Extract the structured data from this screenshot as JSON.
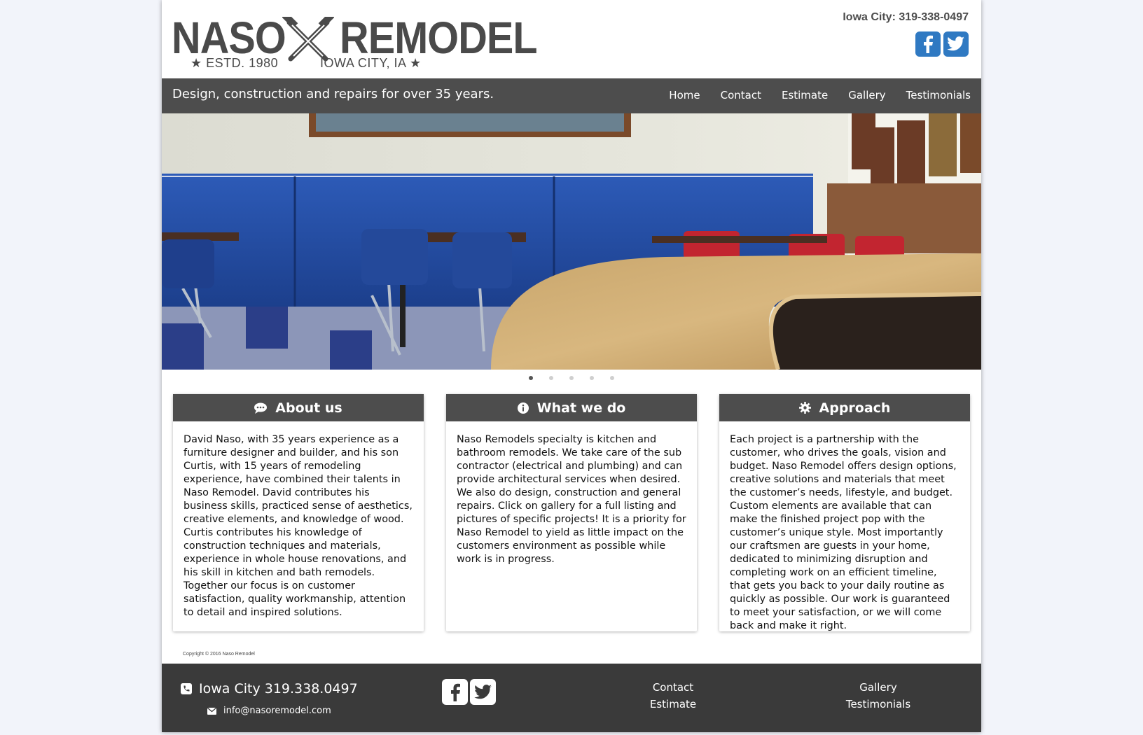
{
  "brand": {
    "logo_left": "NASO",
    "logo_right": "REMODEL",
    "est": "★ ESTD. 1980",
    "location": "IOWA CITY, IA ★",
    "logo_color": "#4a4a4a"
  },
  "header": {
    "phone": "Iowa City: 319-338-0497",
    "social_icons": [
      "facebook-icon",
      "twitter-icon"
    ],
    "social_color": "#2f79c2"
  },
  "navbar": {
    "tagline": "Design, construction and repairs for over 35 years.",
    "items": [
      "Home",
      "Contact",
      "Estimate",
      "Gallery",
      "Testimonials"
    ],
    "background": "#4d4d4d"
  },
  "slider": {
    "image_description_icon": "restaurant-interior-photo",
    "slide_count": 5,
    "active_slide": 1
  },
  "cards": [
    {
      "icon": "chat-bubble-icon",
      "title": "About us",
      "body": "David Naso, with 35 years experience as a furniture designer and builder, and his son Curtis, with 15 years of remodeling experience, have combined their talents in Naso Remodel. David contributes his business skills, practiced sense of aesthetics, creative elements, and knowledge of wood. Curtis contributes his knowledge of construction techniques and materials, experience in whole house renovations, and his skill in kitchen and bath remodels. Together our focus is on customer satisfaction, quality workmanship, attention to detail and inspired solutions."
    },
    {
      "icon": "info-icon",
      "title": "What we do",
      "body": "Naso Remodels specialty is kitchen and bathroom remodels. We take care of the sub contractor (electrical and plumbing) and can provide architectural services when desired. We also do design, construction and general repairs. Click on gallery for a full listing and pictures of specific projects! It is a priority for Naso Remodel to yield as little impact on the customers environment as possible while work is in progress."
    },
    {
      "icon": "gear-icon",
      "title": "Approach",
      "body": "Each project is a partnership with the customer, who drives the goals, vision and budget. Naso Remodel offers design options, creative solutions and materials that meet the customer’s needs, lifestyle, and budget. Custom elements are available that can make the finished project pop with the customer’s unique style. Most importantly our craftsmen are guests in your home, dedicated to minimizing disruption and completing work on an efficient timeline, that gets you back to your daily routine as quickly as possible. Our work is guaranteed to meet your satisfaction, or we will come back and make it right."
    }
  ],
  "copyright": "Copyright © 2016 Naso Remodel",
  "footer": {
    "phone": "Iowa City 319.338.0497",
    "email": "info@nasoremodel.com",
    "links_col1": [
      "Contact",
      "Estimate"
    ],
    "links_col2": [
      "Gallery",
      "Testimonials"
    ],
    "background": "#3a3a3a"
  }
}
